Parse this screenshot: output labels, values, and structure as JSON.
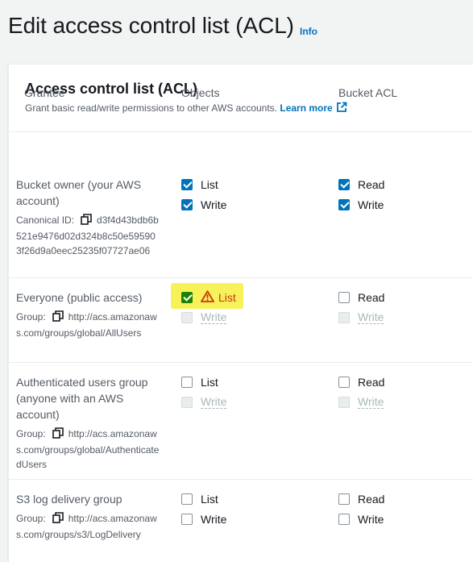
{
  "header": {
    "title": "Edit access control list (ACL)",
    "info_link": "Info"
  },
  "panel": {
    "title": "Access control list (ACL)",
    "description": "Grant basic read/write permissions to other AWS accounts.",
    "learn_more": "Learn more"
  },
  "columns": {
    "grantee": "Grantee",
    "objects": "Objects",
    "bucket_acl": "Bucket ACL"
  },
  "grantees": [
    {
      "name": "Bucket owner (your AWS account)",
      "meta_label": "Canonical ID:",
      "meta_value": "d3f4d43bdb6b521e9476d02d324b8c50e595903f26d9a0eec25235f07727ae06",
      "objects": [
        {
          "label": "List",
          "checked": true,
          "disabled": false
        },
        {
          "label": "Write",
          "checked": true,
          "disabled": false
        }
      ],
      "bucket_acl": [
        {
          "label": "Read",
          "checked": true,
          "disabled": false
        },
        {
          "label": "Write",
          "checked": true,
          "disabled": false
        }
      ]
    },
    {
      "name": "Everyone (public access)",
      "meta_label": "Group:",
      "meta_value": "http://acs.amazonaws.com/groups/global/AllUsers",
      "objects": [
        {
          "label": "List",
          "checked": true,
          "disabled": false,
          "warning": true
        },
        {
          "label": "Write",
          "checked": false,
          "disabled": true
        }
      ],
      "bucket_acl": [
        {
          "label": "Read",
          "checked": false,
          "disabled": false
        },
        {
          "label": "Write",
          "checked": false,
          "disabled": true
        }
      ]
    },
    {
      "name": "Authenticated users group (anyone with an AWS account)",
      "meta_label": "Group:",
      "meta_value": "http://acs.amazonaws.com/groups/global/AuthenticatedUsers",
      "objects": [
        {
          "label": "List",
          "checked": false,
          "disabled": false
        },
        {
          "label": "Write",
          "checked": false,
          "disabled": true
        }
      ],
      "bucket_acl": [
        {
          "label": "Read",
          "checked": false,
          "disabled": false
        },
        {
          "label": "Write",
          "checked": false,
          "disabled": true
        }
      ]
    },
    {
      "name": "S3 log delivery group",
      "meta_label": "Group:",
      "meta_value": "http://acs.amazonaws.com/groups/s3/LogDelivery",
      "objects": [
        {
          "label": "List",
          "checked": false,
          "disabled": false
        },
        {
          "label": "Write",
          "checked": false,
          "disabled": false
        }
      ],
      "bucket_acl": [
        {
          "label": "Read",
          "checked": false,
          "disabled": false
        },
        {
          "label": "Write",
          "checked": false,
          "disabled": false
        }
      ]
    }
  ],
  "colors": {
    "link": "#0073bb",
    "checkbox_checked": "#0073bb",
    "warning": "#d13212",
    "highlight": "#f7f25a"
  }
}
